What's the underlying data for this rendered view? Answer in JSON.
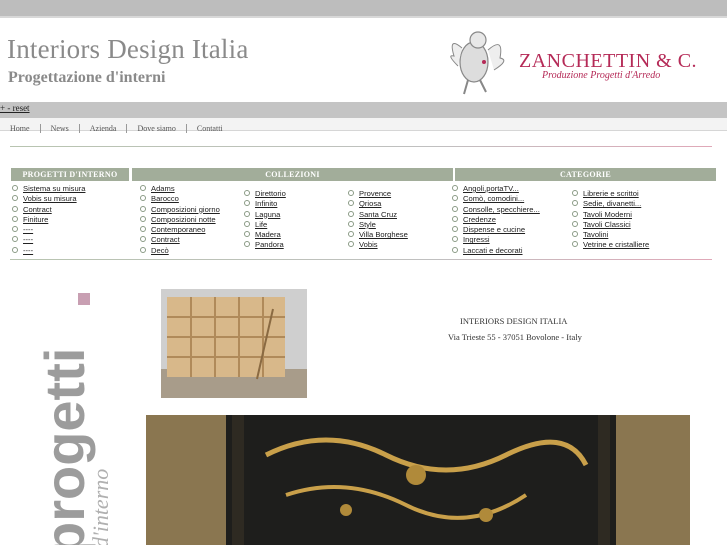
{
  "header": {
    "title": "Interiors Design Italia",
    "subtitle": "Progettazione d'interni",
    "brand": "ZANCHETTIN & C.",
    "brand_tagline": "Produzione Progetti d'Arredo"
  },
  "reset_link": "+ - reset",
  "nav": [
    "Home",
    "News",
    "Azienda",
    "Dove siamo",
    "Contatti"
  ],
  "columns": {
    "progetti": {
      "heading": "PROGETTI D'INTERNO",
      "items": [
        "Sistema su misura",
        "Vobis su misura",
        "Contract",
        "Finiture",
        "----",
        "----",
        "----"
      ]
    },
    "collezioni": {
      "heading": "COLLEZIONI",
      "col1": [
        "Adams",
        "Barocco",
        "Composizioni giorno",
        "Composizioni notte",
        "Contemporaneo",
        "Contract",
        "Decò"
      ],
      "col2": [
        "Direttorio",
        "Infinito",
        "Laguna",
        "Life",
        "Madera",
        "Pandora"
      ],
      "col3": [
        "Provence",
        "Qriosa",
        "Santa Cruz",
        "Style",
        "Villa Borghese",
        "Vobis"
      ]
    },
    "categorie": {
      "heading": "CATEGORIE",
      "col1": [
        "Angoli,portaTV...",
        "Comò, comodini...",
        "Consolle, specchiere...",
        "Credenze",
        "Dispense e cucine",
        "Ingressi",
        "Laccati e decorati"
      ],
      "col2": [
        "Librerie e scrittoi",
        "Sedie, divanetti...",
        "Tavoli Moderni",
        "Tavoli Classici",
        "Tavolini",
        "Vetrine e cristalliere"
      ]
    }
  },
  "vertical_logo_text": "progetti",
  "vertical_logo_sub": "d'interno",
  "address": {
    "company": "INTERIORS DESIGN ITALIA",
    "street": "Via Trieste 55 - 37051 Bovolone - Italy"
  },
  "colors": {
    "header_band": "#a2ad9a",
    "brand": "#b52a57",
    "accent_pink": "#c8a0b0"
  }
}
